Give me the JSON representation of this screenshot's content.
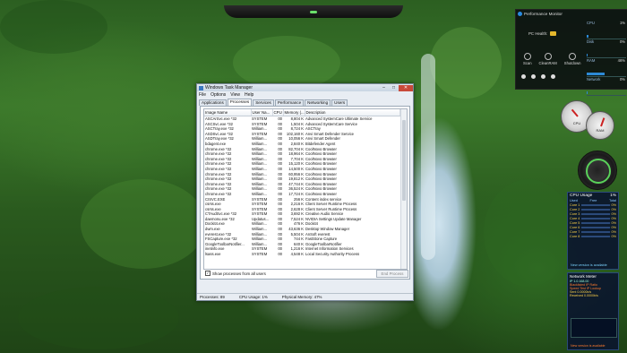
{
  "task_manager": {
    "title": "Windows Task Manager",
    "menu": [
      "File",
      "Options",
      "View",
      "Help"
    ],
    "tabs": [
      "Applications",
      "Processes",
      "Services",
      "Performance",
      "Networking",
      "Users"
    ],
    "active_tab": "Processes",
    "columns": [
      "Image Name",
      "User Na...",
      "CPU",
      "Memory (...",
      "Description"
    ],
    "rows": [
      [
        "ASCArSvc.exe *32",
        "SYSTEM",
        "00",
        "8,804 K",
        "Advanced SystemCare Ultimate Service"
      ],
      [
        "ASCSvc.exe *32",
        "SYSTEM",
        "00",
        "1,504 K",
        "Advanced SystemCare Service"
      ],
      [
        "ASCTray.exe *32",
        "William...",
        "00",
        "8,724 K",
        "ASCTray"
      ],
      [
        "ASDSvc.exe *32",
        "SYSTEM",
        "00",
        "102,160 K",
        "Anvi Smart Defender Service"
      ],
      [
        "ASDTray.exe *32",
        "William...",
        "00",
        "10,056 K",
        "Anvi Smart Defender"
      ],
      [
        "bdagent.exe",
        "William...",
        "00",
        "2,840 K",
        "Bitdefender Agent"
      ],
      [
        "chrome.exe *32",
        "William...",
        "00",
        "82,704 K",
        "CoolNovo Browser"
      ],
      [
        "chrome.exe *32",
        "William...",
        "00",
        "18,964 K",
        "CoolNovo Browser"
      ],
      [
        "chrome.exe *32",
        "William...",
        "00",
        "7,704 K",
        "CoolNovo Browser"
      ],
      [
        "chrome.exe *32",
        "William...",
        "00",
        "15,120 K",
        "CoolNovo Browser"
      ],
      [
        "chrome.exe *32",
        "William...",
        "00",
        "14,500 K",
        "CoolNovo Browser"
      ],
      [
        "chrome.exe *32",
        "William...",
        "00",
        "60,956 K",
        "CoolNovo Browser"
      ],
      [
        "chrome.exe *32",
        "William...",
        "00",
        "19,812 K",
        "CoolNovo Browser"
      ],
      [
        "chrome.exe *32",
        "William...",
        "00",
        "47,744 K",
        "CoolNovo Browser"
      ],
      [
        "chrome.exe *32",
        "William...",
        "00",
        "36,524 K",
        "CoolNovo Browser"
      ],
      [
        "chrome.exe *32",
        "William...",
        "00",
        "17,724 K",
        "CoolNovo Browser"
      ],
      [
        "CISVC.EXE",
        "SYSTEM",
        "00",
        "256 K",
        "Content index service"
      ],
      [
        "csrss.exe",
        "SYSTEM",
        "00",
        "2,216 K",
        "Client Server Runtime Process"
      ],
      [
        "csrss.exe",
        "SYSTEM",
        "00",
        "2,628 K",
        "Client Server Runtime Process"
      ],
      [
        "CTAudSvc.exe *32",
        "SYSTEM",
        "00",
        "3,692 K",
        "Creative Audio Service"
      ],
      [
        "daemonu.exe *32",
        "Updatus...",
        "00",
        "7,524 K",
        "NVIDIA Settings Update Manager"
      ],
      [
        "Dockit4.exe",
        "William...",
        "00",
        "476 K",
        "Dockit4"
      ],
      [
        "dwm.exe",
        "William...",
        "00",
        "43,636 K",
        "Desktop Window Manager"
      ],
      [
        "everest.exe *32",
        "William...",
        "00",
        "5,504 K",
        "AnSoft everest"
      ],
      [
        "FSCapture.exe *32",
        "William...",
        "00",
        "744 K",
        "FastStone Capture"
      ],
      [
        "GoogleToolbarNotifier...",
        "William...",
        "00",
        "640 K",
        "GoogleToolbarNotifier"
      ],
      [
        "inetinfo.exe",
        "SYSTEM",
        "00",
        "1,216 K",
        "Internet Information Services"
      ],
      [
        "lsass.exe",
        "SYSTEM",
        "00",
        "4,548 K",
        "Local Security Authority Process"
      ]
    ],
    "show_all_label": "Show processes from all users",
    "show_all_checked": "✓",
    "end_process_label": "End Process",
    "status": {
      "processes": "Processes: 89",
      "cpu": "CPU Usage: 1%",
      "memory": "Physical Memory: 47%"
    },
    "window_buttons": [
      "–",
      "□",
      "✕"
    ]
  },
  "performance_monitor": {
    "title": "Performance Monitor",
    "health_label": "PC Health:",
    "buttons": [
      "Scan",
      "CleanRAM",
      "Shutdown"
    ],
    "bars": [
      {
        "label": "CPU",
        "value": "1%"
      },
      {
        "label": "Disk",
        "value": "0%"
      },
      {
        "label": "RAM",
        "value": "46%"
      },
      {
        "label": "Network",
        "value": "0%"
      }
    ]
  },
  "gauges": {
    "labels": [
      "CPU",
      "RAM"
    ]
  },
  "cpu_gadget": {
    "title": "CPU Usage",
    "value": "1%",
    "headers": [
      "Used",
      "Free",
      "Total"
    ],
    "cores": [
      "Core 1",
      "Core 2",
      "Core 3",
      "Core 4",
      "Core 5",
      "Core 6",
      "Core 7",
      "Core 8"
    ],
    "core_values": [
      "0%",
      "0%",
      "0%",
      "0%",
      "0%",
      "0%",
      "0%",
      "0%"
    ],
    "link": "New version is available"
  },
  "network_meter": {
    "title": "Network Meter",
    "lines": [
      "IP 1.0.168.00",
      "Blacklisted IP Ratio",
      "Speed Test     IP Lookup",
      "Sent  0.0000b/s",
      "Received  0.0000b/s"
    ],
    "link": "New version is available"
  },
  "colors": {
    "accent": "#2c89d6",
    "cpu_core": "#ffd34a",
    "network_warn": "#ff7b2f"
  }
}
